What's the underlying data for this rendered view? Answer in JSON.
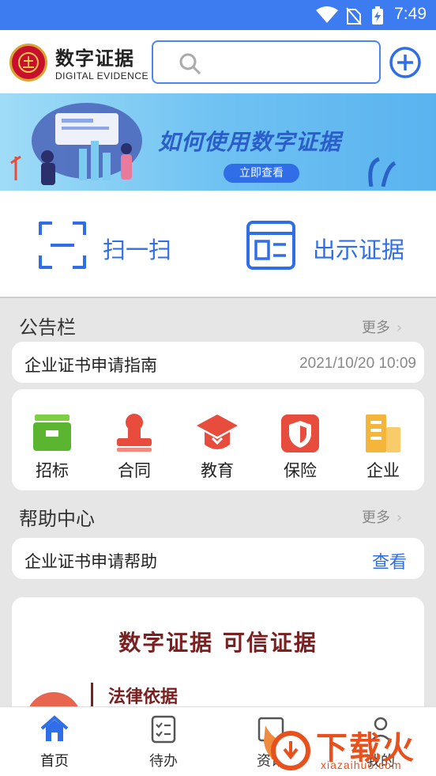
{
  "status_bar": {
    "time": "7:49"
  },
  "header": {
    "app_title": "数字证据",
    "app_subtitle": "DIGITAL EVIDENCE",
    "search_placeholder": ""
  },
  "banner": {
    "title": "如何使用数字证据",
    "cta": "立即查看"
  },
  "actions": [
    {
      "label": "扫一扫",
      "icon": "scan-icon"
    },
    {
      "label": "出示证据",
      "icon": "id-card-icon"
    }
  ],
  "notice": {
    "section_title": "公告栏",
    "more": "更多",
    "item": {
      "title": "企业证书申请指南",
      "date": "2021/10/20 10:09"
    }
  },
  "categories": [
    {
      "label": "招标",
      "icon": "archive-box-icon",
      "color": "#5cb531"
    },
    {
      "label": "合同",
      "icon": "seal-stamp-icon",
      "color": "#e84c3d"
    },
    {
      "label": "教育",
      "icon": "graduation-cap-icon",
      "color": "#e84c3d"
    },
    {
      "label": "保险",
      "icon": "shield-icon",
      "color": "#e84c3d"
    },
    {
      "label": "企业",
      "icon": "building-icon",
      "color": "#f4b63a"
    }
  ],
  "help": {
    "section_title": "帮助中心",
    "more": "更多",
    "item": {
      "title": "企业证书申请帮助",
      "action": "查看"
    }
  },
  "promo": {
    "slogan": "数字证据    可信证据",
    "legal_heading": "法律依据"
  },
  "bottom_nav": [
    {
      "label": "首页",
      "icon": "home-icon",
      "active": true
    },
    {
      "label": "待办",
      "icon": "checklist-icon",
      "active": false
    },
    {
      "label": "资讯",
      "icon": "news-icon",
      "active": false
    },
    {
      "label": "我的",
      "icon": "profile-icon",
      "active": false
    }
  ],
  "watermark": {
    "brand": "下载火",
    "url": "xiazaihuo.com"
  },
  "colors": {
    "primary": "#2f6ee6",
    "statusbar": "#3d7bf0",
    "accent_red": "#7a2020"
  }
}
